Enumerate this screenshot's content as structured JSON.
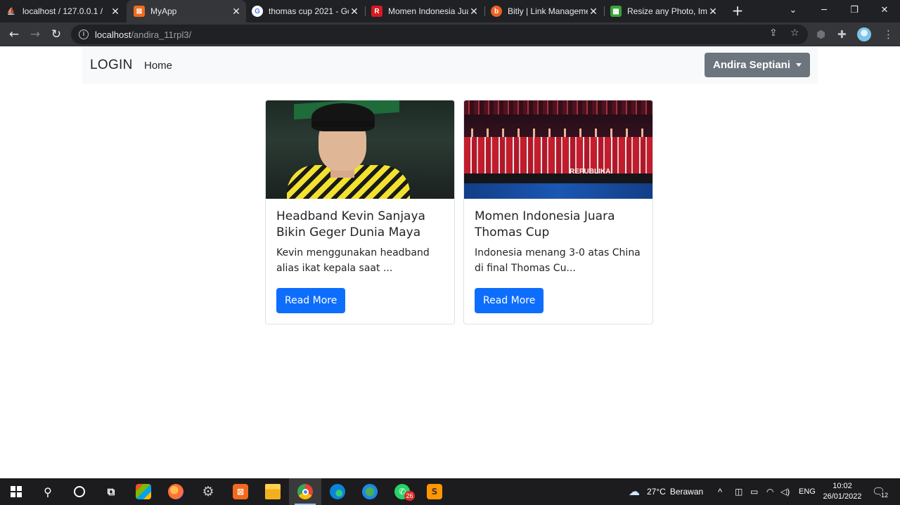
{
  "browser": {
    "tabs": [
      {
        "title": "localhost / 127.0.0.1 /",
        "favicon": "phpmyadmin-icon",
        "fav_color": "#f08a24",
        "active": false
      },
      {
        "title": "MyApp",
        "favicon": "xampp-icon",
        "fav_color": "#f26b1d",
        "active": true
      },
      {
        "title": "thomas cup 2021 - Go",
        "favicon": "google-icon",
        "fav_color": "#ffffff",
        "active": false
      },
      {
        "title": "Momen Indonesia Jua",
        "favicon": "republika-icon",
        "fav_color": "#d71920",
        "active": false
      },
      {
        "title": "Bitly | Link Manageme",
        "favicon": "bitly-icon",
        "fav_color": "#ee6123",
        "active": false
      },
      {
        "title": "Resize any Photo, Ima",
        "favicon": "resize-icon",
        "fav_color": "#3ba13b",
        "active": false
      }
    ],
    "address": {
      "host": "localhost",
      "path": "/andira_11rpl3/"
    }
  },
  "navbar": {
    "brand": "LOGIN",
    "links": [
      "Home"
    ],
    "user_button": "Andira Septiani"
  },
  "cards": [
    {
      "title": "Headband Kevin Sanjaya Bikin Geger Dunia Maya",
      "text": "Kevin menggunakan headband alias ikat kepala saat ...",
      "button": "Read More"
    },
    {
      "title": "Momen Indonesia Juara Thomas Cup",
      "text": "Indonesia menang 3-0 atas China di final Thomas Cu...",
      "button": "Read More",
      "image_caption": "REPUBLIKA"
    }
  ],
  "taskbar": {
    "apps": [
      "windows-start-icon",
      "search-icon",
      "cortana-icon",
      "task-view-icon",
      "microsoft-store-icon",
      "firefox-icon",
      "settings-icon",
      "xampp-icon",
      "file-explorer-icon",
      "chrome-icon",
      "edge-icon",
      "network-app-icon",
      "whatsapp-icon",
      "sublime-text-icon"
    ],
    "whatsapp_badge": "26",
    "weather": {
      "temp": "27°C",
      "desc": "Berawan"
    },
    "language": "ENG",
    "time": "10:02",
    "date": "26/01/2022",
    "notifications": "12"
  },
  "colors": {
    "primary": "#0d6efd",
    "secondary": "#6c757d",
    "navbar_bg": "#f8f9fa"
  }
}
